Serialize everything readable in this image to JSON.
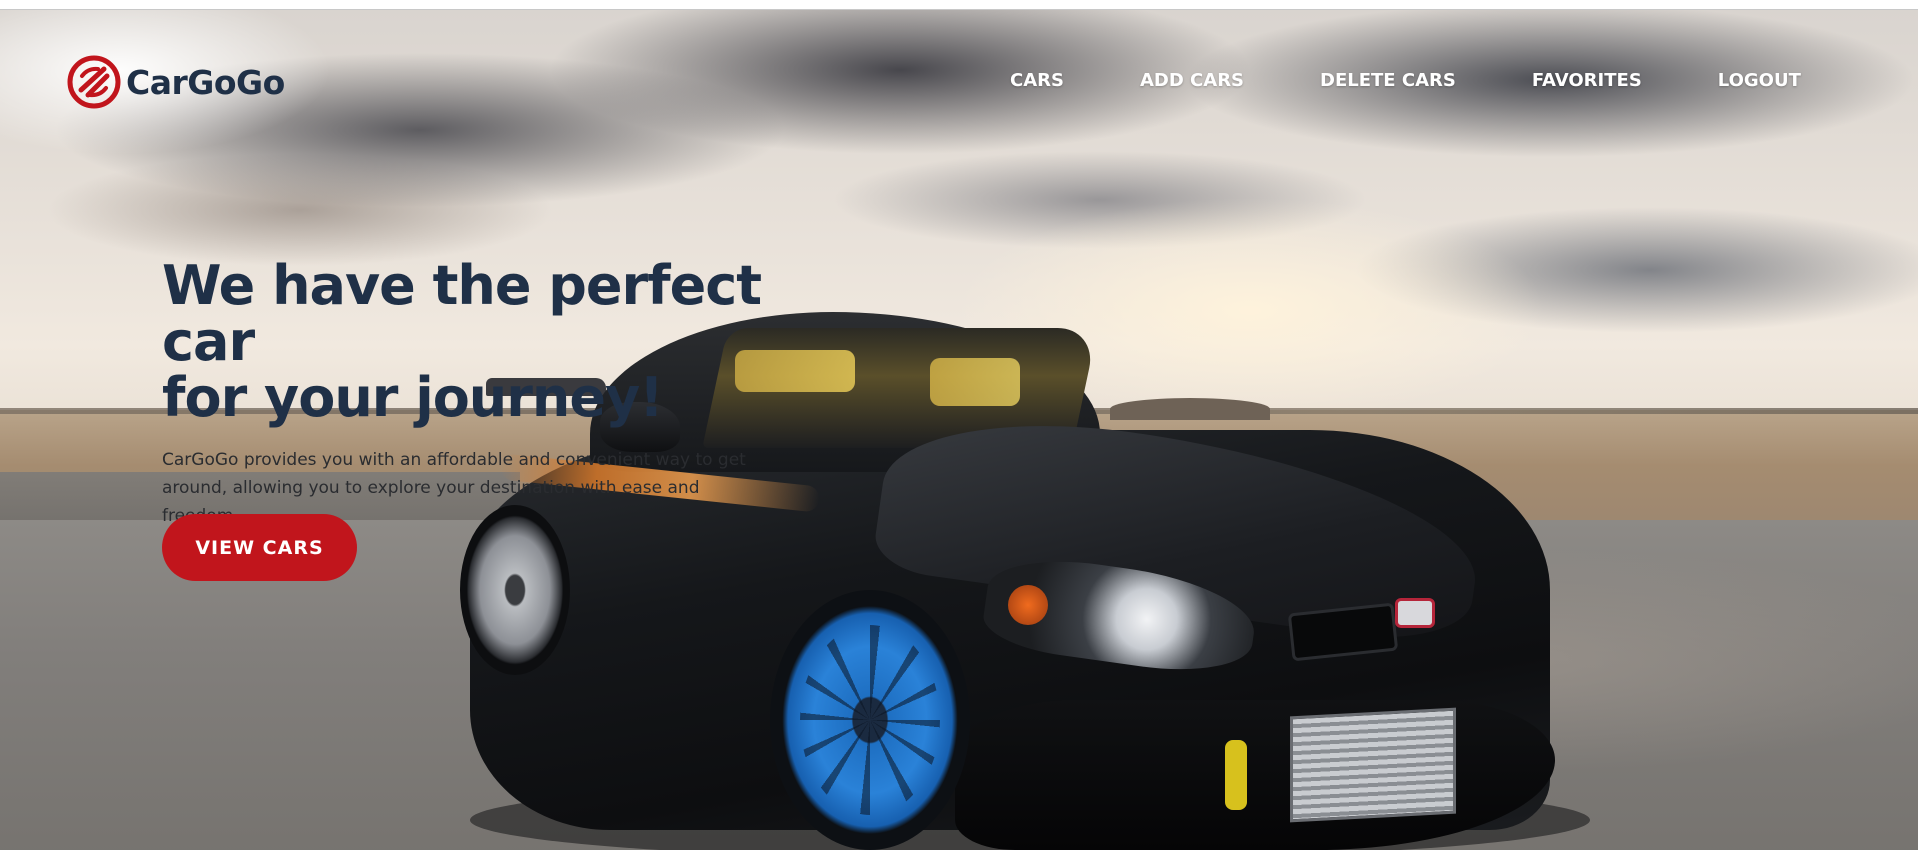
{
  "brand": {
    "name": "CarGoGo",
    "logo_icon": "cargogo-logo-icon",
    "accent_color": "#c1151c",
    "text_color": "#1f3047"
  },
  "nav": {
    "items": [
      {
        "label": "CARS"
      },
      {
        "label": "ADD CARS"
      },
      {
        "label": "DELETE CARS"
      },
      {
        "label": "FAVORITES"
      },
      {
        "label": "LOGOUT"
      }
    ]
  },
  "hero": {
    "title_line1": "We have the perfect car",
    "title_line2": "for your journey!",
    "subtitle": "CarGoGo provides you with an affordable and convenient way to get around, allowing you to explore your destination with ease and freedom.",
    "cta_label": "VIEW CARS",
    "background_image": "sports car on desert road under cloudy sky"
  }
}
